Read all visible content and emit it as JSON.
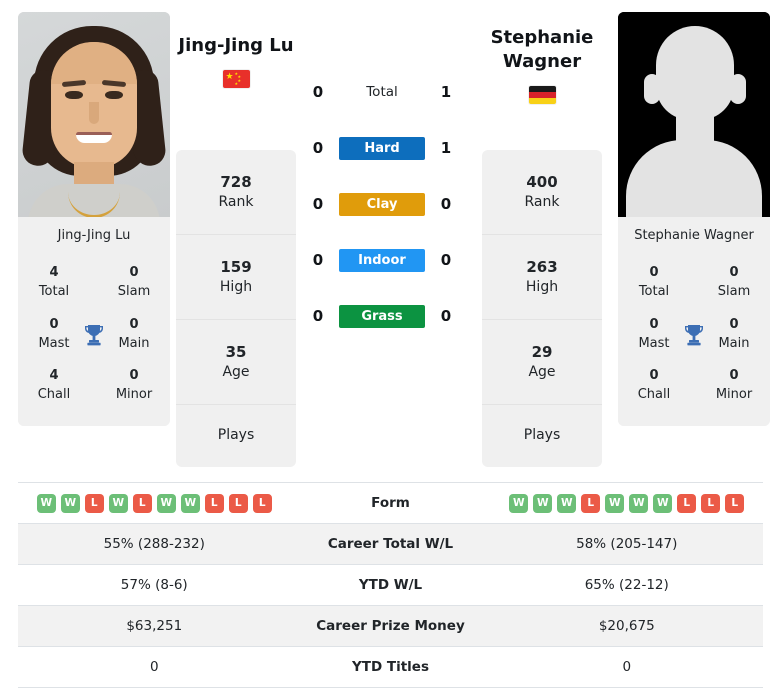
{
  "players": {
    "left": {
      "name": "Jing-Jing Lu",
      "photo_caption": "Jing-Jing Lu",
      "country_code": "CN",
      "flag_icon": "flag-china-icon",
      "titles": [
        {
          "value": "4",
          "label": "Total"
        },
        {
          "value": "0",
          "label": "Slam"
        },
        {
          "value": "0",
          "label": "Mast"
        },
        {
          "value": "0",
          "label": "Main"
        },
        {
          "value": "4",
          "label": "Chall"
        },
        {
          "value": "0",
          "label": "Minor"
        }
      ],
      "stats": [
        {
          "value": "728",
          "label": "Rank"
        },
        {
          "value": "159",
          "label": "High"
        },
        {
          "value": "35",
          "label": "Age"
        },
        {
          "value": "",
          "label": "Plays"
        }
      ],
      "form": [
        "W",
        "W",
        "L",
        "W",
        "L",
        "W",
        "W",
        "L",
        "L",
        "L"
      ],
      "career_total_wl": "55% (288-232)",
      "ytd_wl": "57% (8-6)",
      "career_prize_money": "$63,251",
      "ytd_titles": "0"
    },
    "right": {
      "name": "Stephanie\nWagner",
      "photo_caption": "Stephanie Wagner",
      "country_code": "DE",
      "flag_icon": "flag-germany-icon",
      "titles": [
        {
          "value": "0",
          "label": "Total"
        },
        {
          "value": "0",
          "label": "Slam"
        },
        {
          "value": "0",
          "label": "Mast"
        },
        {
          "value": "0",
          "label": "Main"
        },
        {
          "value": "0",
          "label": "Chall"
        },
        {
          "value": "0",
          "label": "Minor"
        }
      ],
      "stats": [
        {
          "value": "400",
          "label": "Rank"
        },
        {
          "value": "263",
          "label": "High"
        },
        {
          "value": "29",
          "label": "Age"
        },
        {
          "value": "",
          "label": "Plays"
        }
      ],
      "form": [
        "W",
        "W",
        "W",
        "L",
        "W",
        "W",
        "W",
        "L",
        "L",
        "L"
      ],
      "career_total_wl": "58% (205-147)",
      "ytd_wl": "65% (22-12)",
      "career_prize_money": "$20,675",
      "ytd_titles": "0"
    }
  },
  "head_to_head": [
    {
      "label": "Total",
      "left": "0",
      "right": "1",
      "color": ""
    },
    {
      "label": "Hard",
      "left": "0",
      "right": "1",
      "color": "#0d6ebd"
    },
    {
      "label": "Clay",
      "left": "0",
      "right": "0",
      "color": "#e09c0b"
    },
    {
      "label": "Indoor",
      "left": "0",
      "right": "0",
      "color": "#2196f3"
    },
    {
      "label": "Grass",
      "left": "0",
      "right": "0",
      "color": "#0c9341"
    }
  ],
  "comparison_rows": [
    {
      "label": "Form",
      "type": "form"
    },
    {
      "label": "Career Total W/L",
      "type": "text",
      "key": "career_total_wl"
    },
    {
      "label": "YTD W/L",
      "type": "text",
      "key": "ytd_wl"
    },
    {
      "label": "Career Prize Money",
      "type": "text",
      "key": "career_prize_money"
    },
    {
      "label": "YTD Titles",
      "type": "text",
      "key": "ytd_titles"
    }
  ],
  "colors": {
    "card_bg": "#f0f0f0",
    "row_alt_bg": "#f2f2f2",
    "win_badge": "#6cbf77",
    "loss_badge": "#eb5a47",
    "trophy": "#3c6eb4",
    "border": "#dee2e6"
  }
}
